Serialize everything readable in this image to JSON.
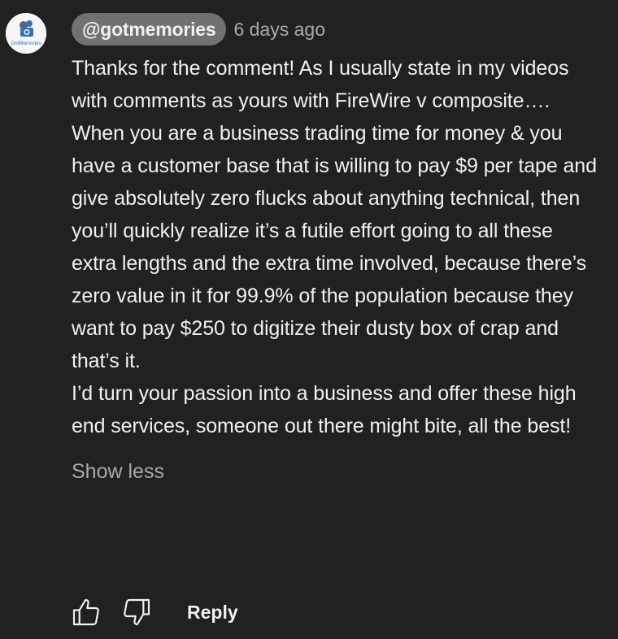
{
  "comment": {
    "handle": "@gotmemories",
    "timestamp": "6 days ago",
    "paragraphs": [
      "Thanks for the comment! As I usually state in my videos with comments as yours with FireWire v composite….",
      "When you are a business trading time for money & you have a customer base that is willing to pay $9 per tape and give absolutely zero flucks about anything technical, then you’ll quickly realize it’s a futile effort going to all these extra lengths and the extra time involved, because there’s zero value in it for 99.9% of the population because they want to pay $250 to digitize their dusty box of crap and that’s it.",
      "I’d turn your passion into a business and offer these high end services, someone out there might bite, all the best!"
    ],
    "show_less_label": "Show less"
  },
  "avatar": {
    "logo_text": "GotMemories",
    "icon": "camera-logo-icon"
  },
  "actions": {
    "like_icon": "thumbs-up-icon",
    "dislike_icon": "thumbs-down-icon",
    "reply_label": "Reply"
  },
  "colors": {
    "background": "#212121",
    "text": "#f1f1f1",
    "secondary_text": "#aaaaaa",
    "handle_pill": "#717171"
  }
}
